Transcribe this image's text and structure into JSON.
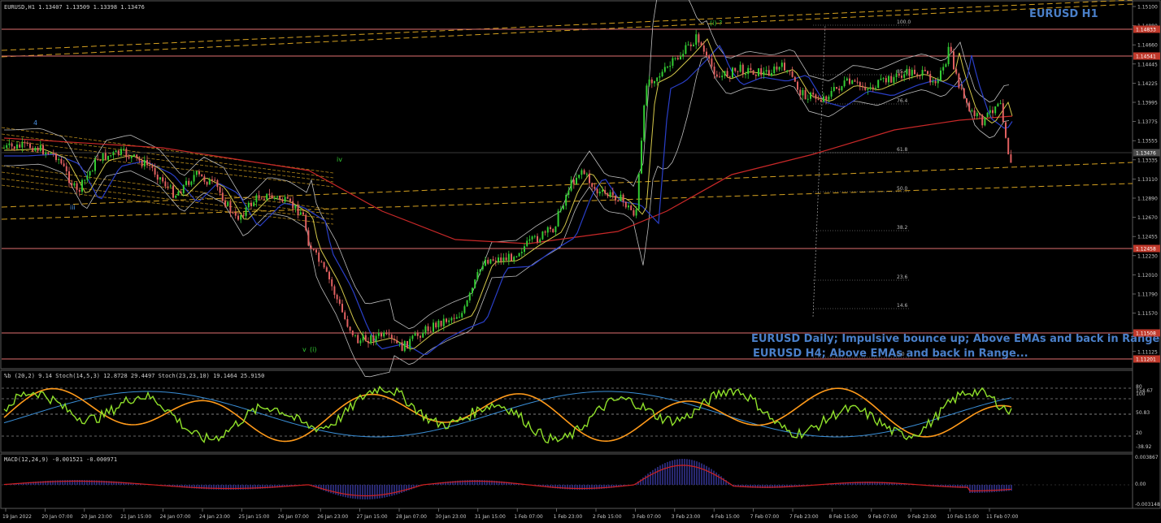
{
  "header": {
    "main": "EURUSD,H1  1.13407 1.13509 1.13398 1.13476",
    "stoch": "%b (20,2) 9.14  Stoch(14,5,3) 12.8728 29.4497  Stoch(23,23,10) 19.1464 25.9150",
    "macd": "MACD(12,24,9) -0.001521 -0.000971"
  },
  "chart_title": "EURUSD H1",
  "annotations": {
    "line1": "EURUSD Daily; Impulsive bounce up; Above EMAs and back in Range",
    "line2": "EURUSD H4; Above EMAs and back in Range...",
    "wave_4": "4",
    "wave_iii": "iii",
    "wave_iv": "iv",
    "wave_v": "v",
    "wave_i": "(i)",
    "wave_i2": "(i) ?"
  },
  "price_axis": {
    "ticks": [
      "1.15100",
      "1.14880",
      "1.14660",
      "1.14445",
      "1.14225",
      "1.13995",
      "1.13775",
      "1.13555",
      "1.13335",
      "1.13110",
      "1.12890",
      "1.12670",
      "1.12455",
      "1.12230",
      "1.12010",
      "1.11790",
      "1.11570",
      "1.11345",
      "1.11125"
    ],
    "level_labels": [
      {
        "value": "1.14833",
        "color": "#c0392b"
      },
      {
        "value": "1.14541",
        "color": "#c0392b"
      },
      {
        "value": "1.13476",
        "color": "#4a4a4a"
      },
      {
        "value": "1.12458",
        "color": "#c0392b"
      },
      {
        "value": "1.11508",
        "color": "#c0392b"
      },
      {
        "value": "1.11201",
        "color": "#c0392b"
      }
    ]
  },
  "fib_labels": [
    "100.0",
    "85.4",
    "76.4",
    "61.8",
    "50.0",
    "38.2",
    "23.6",
    "14.6",
    "0.0"
  ],
  "stoch_axis": [
    "154.67",
    "100",
    "80",
    "50.83",
    "20",
    "-38.92"
  ],
  "macd_axis": [
    "0.003867",
    "0.00",
    "-0.003148"
  ],
  "time_axis": [
    "19 Jan 2022",
    "20 Jan 07:00",
    "20 Jan 23:00",
    "21 Jan 15:00",
    "24 Jan 07:00",
    "24 Jan 23:00",
    "25 Jan 15:00",
    "26 Jan 07:00",
    "26 Jan 23:00",
    "27 Jan 15:00",
    "28 Jan 07:00",
    "30 Jan 23:00",
    "31 Jan 15:00",
    "1 Feb 07:00",
    "1 Feb 23:00",
    "2 Feb 15:00",
    "3 Feb 07:00",
    "3 Feb 23:00",
    "4 Feb 15:00",
    "7 Feb 07:00",
    "7 Feb 23:00",
    "8 Feb 15:00",
    "9 Feb 07:00",
    "9 Feb 23:00",
    "10 Feb 15:00",
    "11 Feb 07:00"
  ],
  "colors": {
    "bull": "#33cc33",
    "bear": "#e06060",
    "ema_fast": "#d4c84a",
    "ema_mid": "#2a3fc8",
    "ema_slow": "#c82828",
    "bollinger": "#bcbcbc",
    "horizontal_level": "#e07070",
    "trend_dashed": "#d4a020",
    "title_blue": "#4a7fc8",
    "stoch_fast": "#8fe02a",
    "stoch_slow": "#ff9a1a",
    "stoch_blue": "#3a8fd8",
    "macd_bar": "#3a3aa0",
    "macd_signal": "#d02020"
  }
}
